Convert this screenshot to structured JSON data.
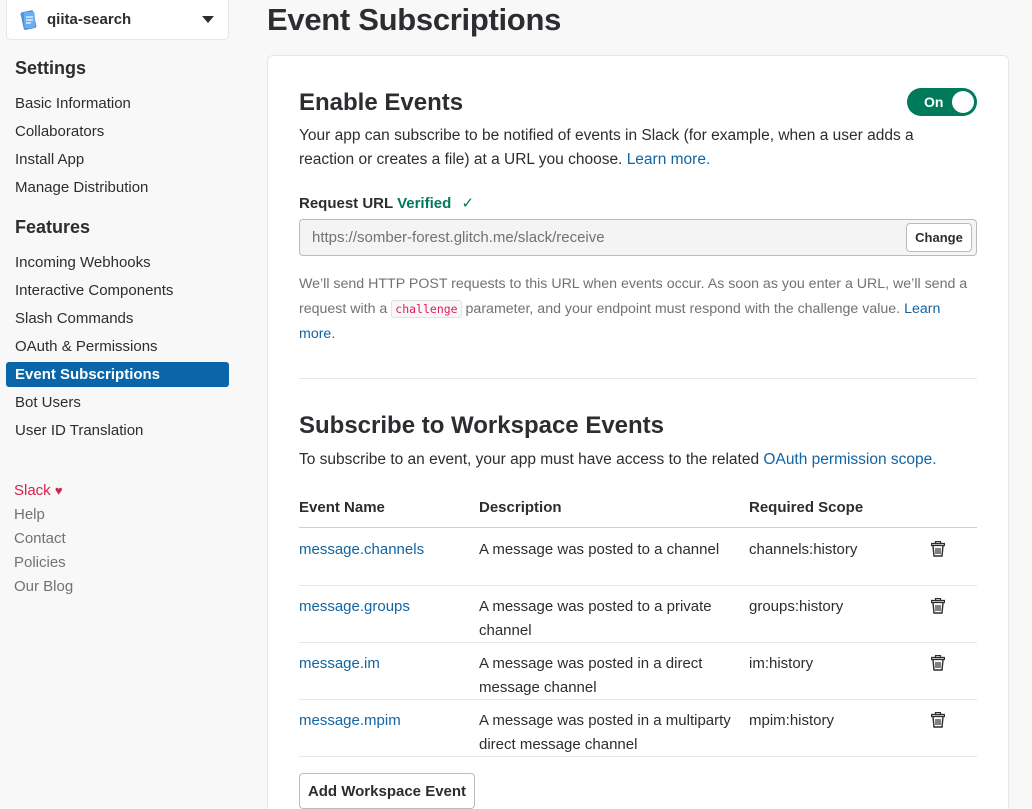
{
  "app_selector": {
    "name": "qiita-search"
  },
  "sidebar": {
    "settings_heading": "Settings",
    "settings_items": [
      "Basic Information",
      "Collaborators",
      "Install App",
      "Manage Distribution"
    ],
    "features_heading": "Features",
    "features_items": [
      "Incoming Webhooks",
      "Interactive Components",
      "Slash Commands",
      "OAuth & Permissions",
      "Event Subscriptions",
      "Bot Users",
      "User ID Translation"
    ],
    "active_item": "Event Subscriptions",
    "footer": {
      "slack": "Slack",
      "help": "Help",
      "contact": "Contact",
      "policies": "Policies",
      "blog": "Our Blog"
    }
  },
  "page": {
    "title": "Event Subscriptions"
  },
  "enable_events": {
    "title": "Enable Events",
    "toggle_label": "On",
    "description": "Your app can subscribe to be notified of events in Slack (for example, when a user adds a reaction or creates a file) at a URL you choose.",
    "learn_more": "Learn more.",
    "request_url_label": "Request URL",
    "verified": "Verified",
    "check": "✓",
    "url_value": "https://somber-forest.glitch.me/slack/receive",
    "change_button": "Change",
    "help_pre": "We’ll send HTTP POST requests to this URL when events occur. As soon as you enter a URL, we’ll send a request with a",
    "help_code": "challenge",
    "help_post": "parameter, and your endpoint must respond with the challenge value.",
    "help_link": "Learn more."
  },
  "workspace_events": {
    "title": "Subscribe to Workspace Events",
    "description": "To subscribe to an event, your app must have access to the related",
    "description_link": "OAuth permission scope.",
    "columns": {
      "event": "Event Name",
      "description": "Description",
      "scope": "Required Scope"
    },
    "rows": [
      {
        "event": "message.channels",
        "description": "A message was posted to a channel",
        "scope": "channels:history"
      },
      {
        "event": "message.groups",
        "description": "A message was posted to a private channel",
        "scope": "groups:history"
      },
      {
        "event": "message.im",
        "description": "A message was posted in a direct message channel",
        "scope": "im:history"
      },
      {
        "event": "message.mpim",
        "description": "A message was posted in a multiparty direct message channel",
        "scope": "mpim:history"
      }
    ],
    "add_button": "Add Workspace Event"
  }
}
